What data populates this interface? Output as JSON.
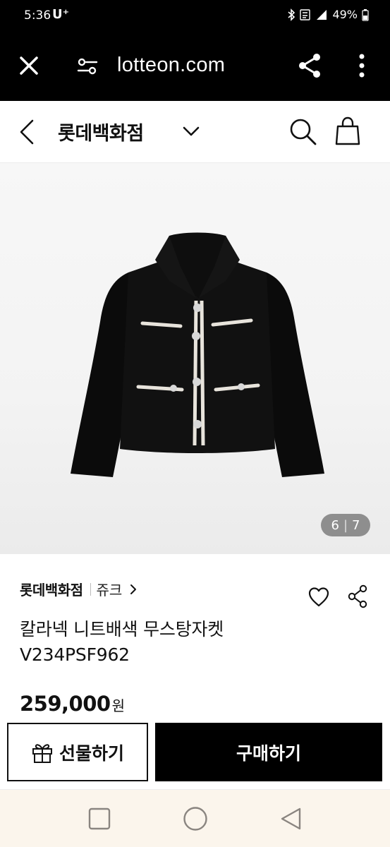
{
  "status_bar": {
    "time": "5:36",
    "carrier": "U⁺",
    "battery": "49%",
    "icons": [
      "bluetooth-icon",
      "volte-icon",
      "signal-icon",
      "battery-icon"
    ]
  },
  "browser": {
    "url": "lotteon.com",
    "icons": [
      "close-icon",
      "site-settings-icon",
      "share-icon",
      "more-icon"
    ]
  },
  "header": {
    "title": "롯데백화점",
    "icons": [
      "back-icon",
      "chevron-down-icon",
      "search-icon",
      "shopping-bag-icon"
    ]
  },
  "gallery": {
    "current": "6",
    "separator": "|",
    "total": "7"
  },
  "product": {
    "brand": "롯데백화점",
    "sub_brand": "쥬크",
    "name": "칼라넥 니트배색 무스탕자켓 V234PSF962",
    "price": "259,000",
    "currency": "원"
  },
  "actions": {
    "gift_label": "선물하기",
    "buy_label": "구매하기"
  },
  "colors": {
    "bar_background": "#000000",
    "nav_background": "#fbf5ec"
  }
}
